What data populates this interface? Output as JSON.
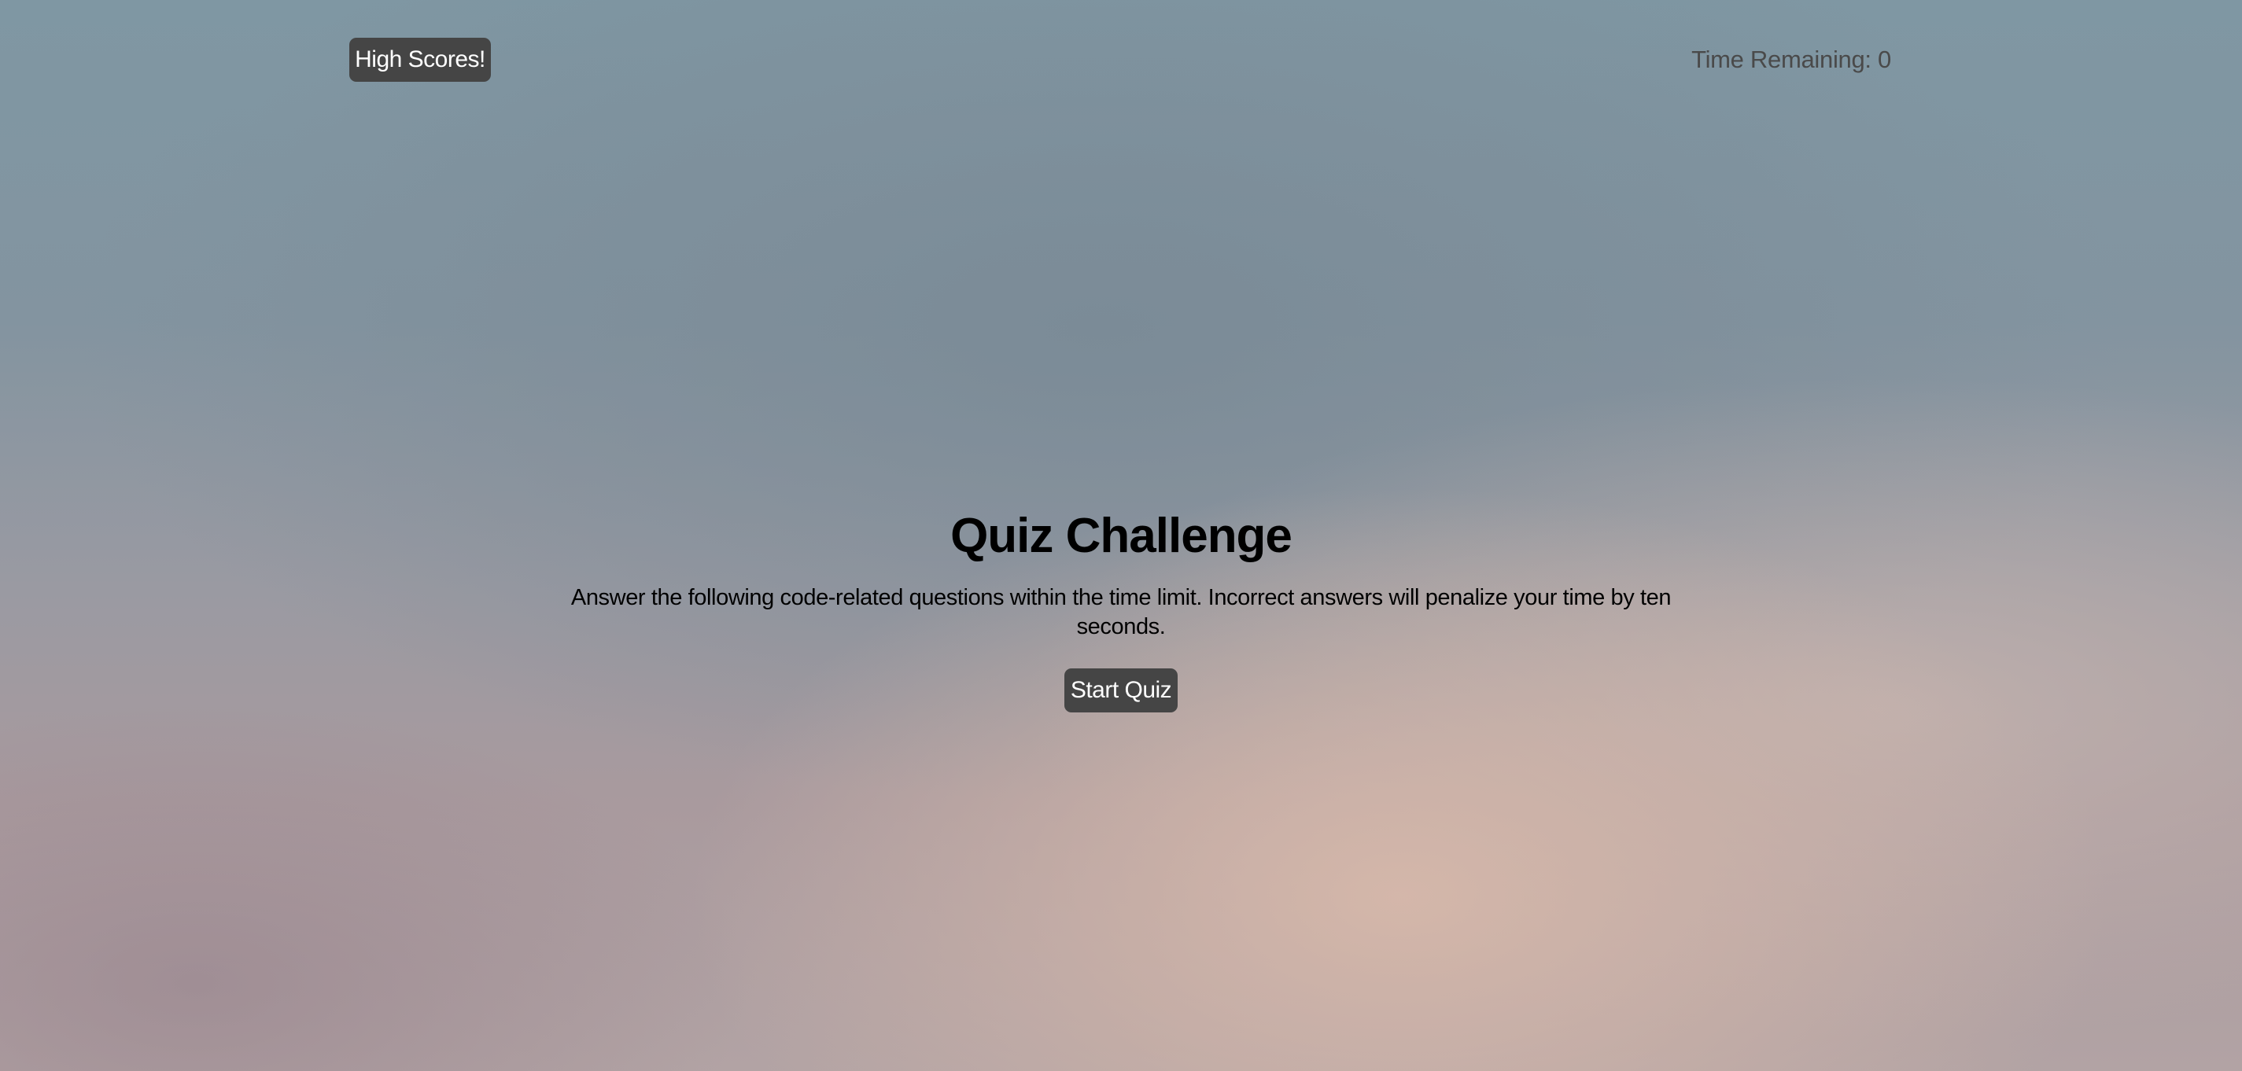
{
  "header": {
    "high_scores_label": "High Scores!",
    "timer_label": "Time Remaining: ",
    "timer_value": "0"
  },
  "intro": {
    "title": "Quiz Challenge",
    "description": "Answer the following code-related questions within the time limit. Incorrect answers will penalize your time by ten seconds.",
    "start_label": "Start Quiz"
  },
  "colors": {
    "button_background": "#454545",
    "button_text": "#ffffff",
    "timer_text": "#4a4a4a",
    "title_text": "#000000"
  }
}
